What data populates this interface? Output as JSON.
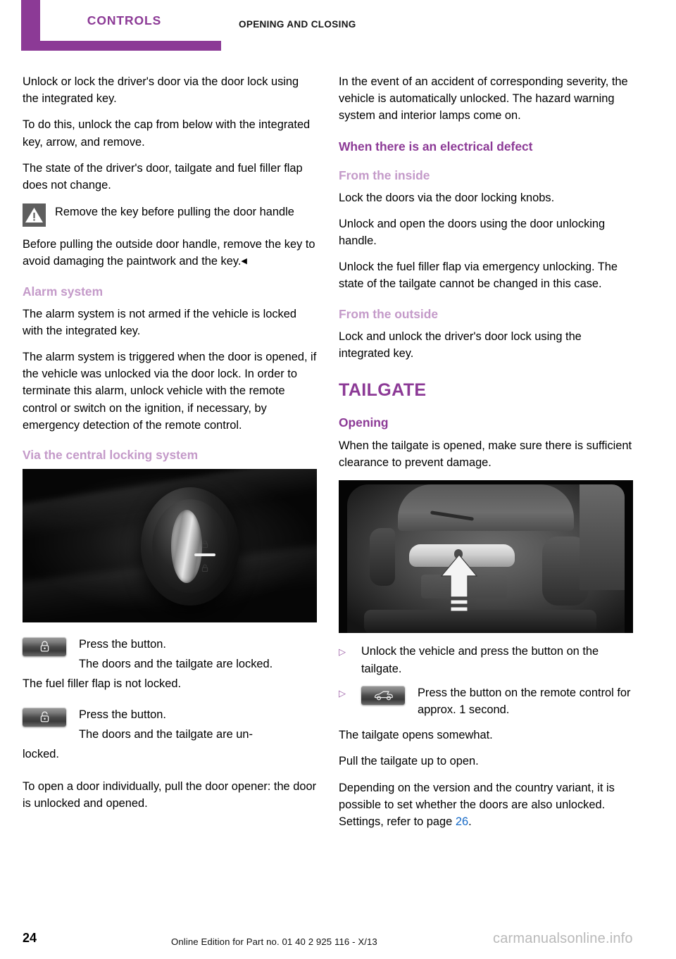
{
  "header": {
    "chapter": "CONTROLS",
    "section": "OPENING AND CLOSING"
  },
  "left_column": {
    "paragraphs": [
      "Unlock or lock the driver's door via the door lock using the integrated key.",
      "To do this, unlock the cap from below with the integrated key, arrow, and remove.",
      "The state of the driver's door, tailgate and fuel filler flap does not change."
    ],
    "warning": {
      "icon": "warning-triangle-icon",
      "title": "Remove the key before pulling the door handle",
      "text": "Before pulling the outside door handle, remove the key to avoid damaging the paintwork and the key.",
      "end_marker": "◀"
    },
    "alarm": {
      "heading": "Alarm system",
      "paragraphs": [
        "The alarm system is not armed if the vehicle is locked with the integrated key.",
        "The alarm system is triggered when the door is opened, if the vehicle was unlocked via the door lock. In order to terminate this alarm, unlock vehicle with the remote control or switch on the ignition, if necessary, by emergency detection of the remote control."
      ]
    },
    "central_locking": {
      "heading": "Via the central locking system",
      "photo_name": "door-lock-knob-photo",
      "lock_entry": {
        "icon": "padlock-closed-icon",
        "line1": "Press the button.",
        "line2": "The doors and the tailgate are locked.",
        "followup": "The fuel filler flap is not locked."
      },
      "unlock_entry": {
        "icon": "padlock-open-icon",
        "line1": "Press the button.",
        "line2": "The doors and the tailgate are un-",
        "followup": "locked."
      },
      "closing_paragraph": "To open a door individually, pull the door opener: the door is unlocked and opened."
    }
  },
  "right_column": {
    "intro_paragraph": "In the event of an accident of corresponding severity, the vehicle is automatically unlocked. The hazard warning system and interior lamps come on.",
    "electrical_defect": {
      "heading": "When there is an electrical defect",
      "from_inside": {
        "heading": "From the inside",
        "paragraphs": [
          "Lock the doors via the door locking knobs.",
          "Unlock and open the doors using the door unlocking handle.",
          "Unlock the fuel filler flap via emergency unlocking. The state of the tailgate cannot be changed in this case."
        ]
      },
      "from_outside": {
        "heading": "From the outside",
        "paragraphs": [
          "Lock and unlock the driver's door lock using the integrated key."
        ]
      }
    },
    "tailgate": {
      "title": "TAILGATE",
      "opening": {
        "heading": "Opening",
        "intro": "When the tailgate is opened, make sure there is sufficient clearance to prevent damage.",
        "photo_name": "tailgate-rear-photo",
        "steps": [
          {
            "bullet": "▷",
            "text": "Unlock the vehicle and press the button on the tailgate.",
            "icon": null
          },
          {
            "bullet": "▷",
            "text": "Press the button on the remote control for approx. 1 second.",
            "icon": "car-tailgate-open-icon"
          }
        ],
        "after_steps": [
          "The tailgate opens somewhat.",
          "Pull the tailgate up to open."
        ],
        "settings_text_before": "Depending on the version and the country variant, it is possible to set whether the doors are also unlocked. Settings, refer to page ",
        "settings_page_ref": "26",
        "settings_text_after": "."
      }
    }
  },
  "footer": {
    "page_number": "24",
    "edition": "Online Edition for Part no. 01 40 2 925 116 - X/13",
    "watermark": "carmanualsonline.info"
  },
  "colors": {
    "brand_purple": "#8C3A96",
    "light_purple": "#C49AC9",
    "bullet_purple": "#9B5CA5",
    "link_blue": "#1569C7",
    "warning_gray": "#5E5E5E"
  }
}
